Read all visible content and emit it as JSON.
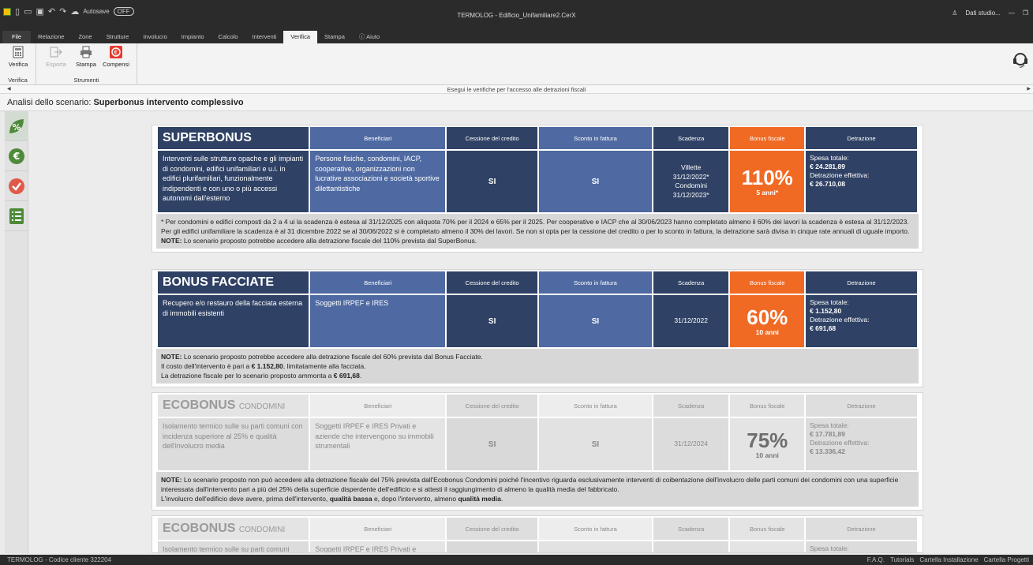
{
  "window": {
    "title": "TERMOLOG - Edificio_Unifamiliare2.CerX",
    "autosave_label": "Autosave",
    "autosave_state": "OFF",
    "user": "Dati studio..."
  },
  "ribbon_tabs": [
    "File",
    "Relazione",
    "Zone",
    "Strutture",
    "Involucro",
    "Impianto",
    "Calcolo",
    "Interventi",
    "Verifica",
    "Stampa",
    "Aiuto"
  ],
  "ribbon": {
    "verifica_label": "Verifica",
    "verifica_group": "Verifica",
    "esporta_label": "Esporta",
    "stampa_label": "Stampa",
    "compensi_label": "Compensi",
    "strumenti_group": "Strumenti"
  },
  "hint": "Esegui le verifiche per l'accesso alle detrazioni fiscali",
  "scenario": {
    "prefix": "Analisi dello scenario:",
    "name": "Superbonus intervento complessivo"
  },
  "headers": {
    "beneficiari": "Beneficiari",
    "cessione": "Cessione del credito",
    "sconto": "Sconto in fattura",
    "scadenza": "Scadenza",
    "bonus": "Bonus fiscale",
    "detrazione": "Detrazione"
  },
  "detr_labels": {
    "spesa": "Spesa totale:",
    "effettiva": "Detrazione effettiva:"
  },
  "yes": "SI",
  "superbonus": {
    "title": "SUPERBONUS",
    "desc": "Interventi sulle strutture opache e gli impianti di condomini, edifici unifamiliari e u.i. in edifici plurifamiliari, funzionalmente indipendenti e con uno o più accessi autonomi dall'esterno",
    "ben": "Persone fisiche, condomini, IACP, cooperative, organizzazioni non lucrative associazioni e società sportive dilettantistiche",
    "scad1": "Villette",
    "scad2": "31/12/2022*",
    "scad3": "Condomini",
    "scad4": "31/12/2023*",
    "pct": "110%",
    "years": "5 anni*",
    "spesa": "€ 24.281,89",
    "detr": "€ 26.710,08",
    "note": "* Per condomini e edifici composti da 2 a 4 ui la scadenza è estesa al 31/12/2025 con aliquota 70% per il 2024 e 65% per il 2025. Per cooperative e IACP che al 30/06/2023 hanno completato almeno il 60% dei lavori la scadenza è estesa al 31/12/2023. Per gli edifici unifamiliare la scadenza è al 31 dicembre 2022 se al 30/06/2022 si è completato almeno il 30% dei lavori. Se non si opta per la cessione del credito o per lo sconto in fattura, la detrazione sarà divisa in cinque rate annuali di uguale importo.",
    "note_bold": "NOTE:",
    "note2": "Lo scenario proposto potrebbe accedere alla detrazione fiscale del 110% prevista dal SuperBonus."
  },
  "facciate": {
    "title": "BONUS FACCIATE",
    "desc": "Recupero e/o restauro della facciata esterna di immobili esistenti",
    "ben": "Soggetti IRPEF e IRES",
    "scad": "31/12/2022",
    "pct": "60%",
    "years": "10 anni",
    "spesa": "€ 1.152,80",
    "detr": "€ 691,68",
    "note_bold": "NOTE:",
    "note1": "Lo scenario proposto potrebbe accedere alla detrazione fiscale del 60% prevista dal Bonus Facciate.",
    "note2a": "Il costo dell'intervento è pari a",
    "note2b": "€ 1.152,80",
    "note2c": ", limitatamente alla facciata.",
    "note3a": "La detrazione fiscale per lo scenario proposto ammonta a",
    "note3b": "€ 691,68",
    "note3c": "."
  },
  "ecobonus": {
    "title": "ECOBONUS",
    "subtitle": "CONDOMINI",
    "desc": "Isolamento termico sulle su parti comuni con incidenza superiore al 25% e qualità dell'involucro media",
    "ben": "Soggetti IRPEF e IRES Privati e aziende che intervengono su immobili strumentali",
    "scad": "31/12/2024",
    "pct": "75%",
    "years": "10 anni",
    "spesa": "€ 17.781,89",
    "detr": "€ 13.336,42",
    "note_bold": "NOTE:",
    "note1": "Lo scenario proposto non può accedere alla detrazione fiscale del 75% prevista dall'Ecobonus Condomini poiché l'incentivo riguarda esclusivamente interventi di coibentazione dell'involucro delle parti comuni dei condomini con una superficie interessata dall'intervento pari a più del 25% della superficie disperdente dell'edificio e si attesti il raggiungimento di almeno la qualità media del fabbricato.",
    "note2a": "L'involucro dell'edificio deve avere, prima dell'intervento,",
    "note2b": "qualità bassa",
    "note2c": "e, dopo l'intervento, almeno",
    "note2d": "qualità media",
    "note2e": "."
  },
  "ecobonus2": {
    "title": "ECOBONUS",
    "subtitle": "CONDOMINI",
    "desc_partial": "Isolamento termico sulle su parti comuni",
    "ben_partial": "Soggetti IRPEF e IRES Privati e",
    "spesa_partial": "Spesa totale:"
  },
  "status": {
    "left": "TERMOLOG - Codice cliente 322204",
    "links": [
      "F.A.Q.",
      "Tutorials",
      "Cartella Installazione",
      "Cartella Progetti"
    ]
  }
}
